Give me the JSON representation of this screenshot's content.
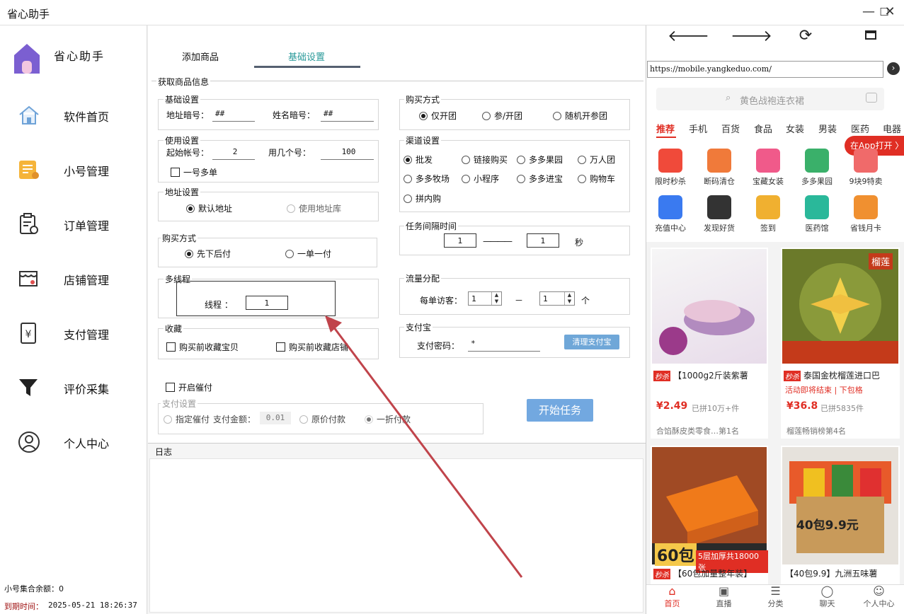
{
  "window": {
    "title": "省心助手",
    "min": "—",
    "max": "☐",
    "close": "✕"
  },
  "sidebar": {
    "brand": "省心助手",
    "items": [
      {
        "label": "软件首页",
        "icon": "home-icon"
      },
      {
        "label": "小号管理",
        "icon": "account-icon"
      },
      {
        "label": "订单管理",
        "icon": "order-icon"
      },
      {
        "label": "店铺管理",
        "icon": "shop-icon"
      },
      {
        "label": "支付管理",
        "icon": "payment-icon"
      },
      {
        "label": "评价采集",
        "icon": "filter-icon"
      },
      {
        "label": "个人中心",
        "icon": "user-icon"
      }
    ],
    "balance": "小号集合余额：0",
    "expiry_label": "到期时间：",
    "expiry_value": "2025-05-21 18:26:37"
  },
  "main": {
    "tabs": [
      {
        "label": "添加商品"
      },
      {
        "label": "基础设置"
      }
    ],
    "fetch_title": "获取商品信息",
    "basic": {
      "title": "基础设置",
      "addr_code_label": "地址暗号：",
      "addr_code": "##",
      "name_code_label": "姓名暗号：",
      "name_code": "##"
    },
    "usage": {
      "title": "使用设置",
      "start_label": "起始帐号：",
      "start": "2",
      "count_label": "用几个号：",
      "count": "100",
      "multi": "一号多单"
    },
    "address": {
      "title": "地址设置",
      "default": "默认地址",
      "library": "使用地址库"
    },
    "paymode": {
      "title": "购买方式",
      "first": "先下后付",
      "each": "一单一付"
    },
    "thread": {
      "title": "多线程",
      "label": "线程 ：",
      "value": "1"
    },
    "collect": {
      "title": "收藏",
      "item": "购买前收藏宝贝",
      "shop": "购买前收藏店铺"
    },
    "urge": {
      "label": "开启催付"
    },
    "paysetting": {
      "title": "支付设置",
      "fixed": "指定催付",
      "amount_label": "支付金额：",
      "amount": "0.01",
      "original": "原价付款",
      "discount": "一折付款"
    },
    "buymode": {
      "title": "购买方式",
      "opts": [
        "仅开团",
        "参/开团",
        "随机开参团"
      ]
    },
    "channel": {
      "title": "渠道设置",
      "opts": [
        "批发",
        "链接购买",
        "多多果园",
        "万人团",
        "多多牧场",
        "小程序",
        "多多进宝",
        "购物车",
        "拼内购"
      ]
    },
    "interval": {
      "title": "任务间隔时间",
      "from": "1",
      "dash": "————",
      "to": "1",
      "unit": "秒"
    },
    "traffic": {
      "title": "流量分配",
      "label": "每单访客：",
      "from": "1",
      "dash": "－",
      "to": "1",
      "unit": "个"
    },
    "alipay": {
      "title": "支付宝",
      "pwd_label": "支付密码：",
      "pwd": "*",
      "clear_btn": "清理支付宝"
    },
    "start_btn": "开始任务",
    "log_title": "日志"
  },
  "browser": {
    "url": "https://mobile.yangkeduo.com/",
    "search_placeholder": "黄色战袍连衣裙",
    "categories": [
      "推荐",
      "手机",
      "百货",
      "食品",
      "女装",
      "男装",
      "医药",
      "电器"
    ],
    "open_app": "在App打开 〉",
    "quick": [
      {
        "label": "限时秒杀",
        "color": "#f04a3a"
      },
      {
        "label": "断码清仓",
        "color": "#f07a3a"
      },
      {
        "label": "宝藏女装",
        "color": "#f05a8a"
      },
      {
        "label": "多多果园",
        "color": "#3ab06a"
      },
      {
        "label": "9块9特卖",
        "color": "#f06a6a"
      },
      {
        "label": "充值中心",
        "color": "#3a7af0"
      },
      {
        "label": "发现好货",
        "color": "#333333"
      },
      {
        "label": "签到",
        "color": "#f0b030"
      },
      {
        "label": "医药馆",
        "color": "#2ab89a"
      },
      {
        "label": "省钱月卡",
        "color": "#f09030"
      }
    ],
    "products": [
      {
        "tag": "秒杀",
        "title": "【1000g2斤装紫薯",
        "price": "¥2.49",
        "sold": "已拼10万+件",
        "rank": "合馅酥皮类零食…第1名"
      },
      {
        "tag": "秒杀",
        "title": "泰国金枕榴莲进口巴",
        "sub": "活动即将结束 | 下包格",
        "price": "¥36.8",
        "sold": "已拼5835件",
        "rank": "榴莲畅销榜第4名",
        "badge": "榴莲"
      },
      {
        "tag": "秒杀",
        "title": "【60包加量整年装】",
        "banner1": "60包",
        "banner2": "5层加厚共18000张"
      },
      {
        "title": "【40包9.9】九洲五味薯",
        "banner1": "40包9.9元"
      }
    ],
    "bottom": [
      "首页",
      "直播",
      "分类",
      "聊天",
      "个人中心"
    ]
  }
}
